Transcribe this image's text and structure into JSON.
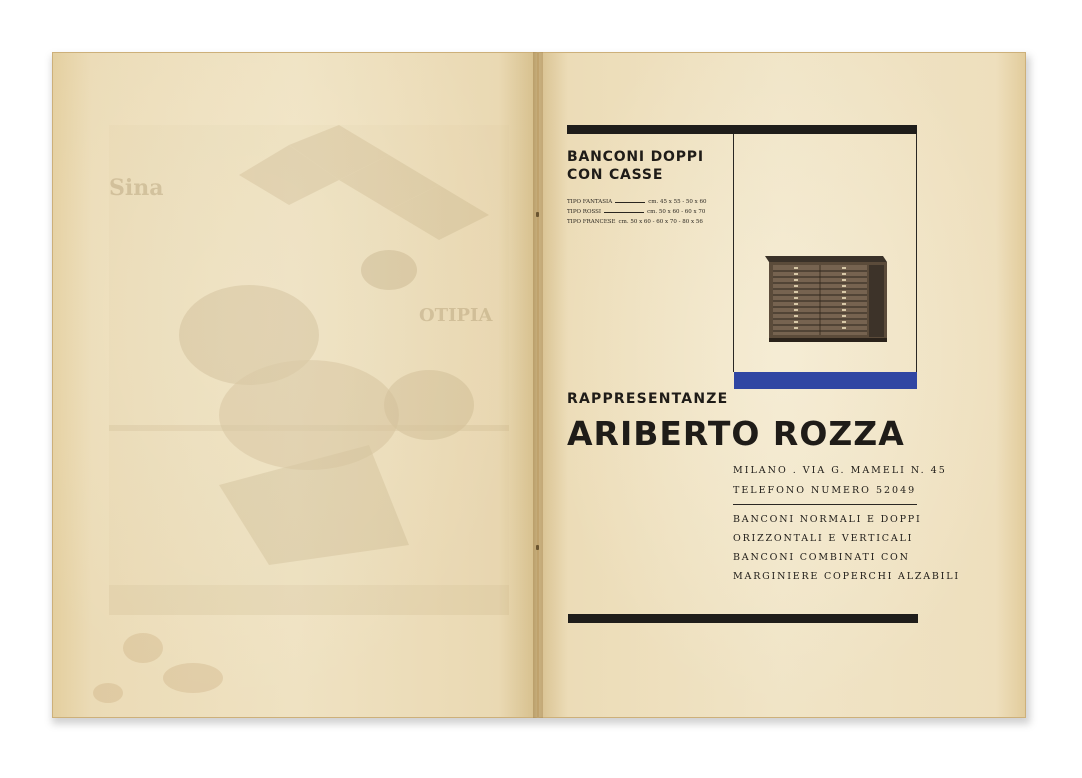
{
  "advertisement": {
    "headline": [
      "BANCONI DOPPI",
      "CON CASSE"
    ],
    "types": [
      {
        "name": "TIPO FANTASIA",
        "sizes": "cm. 45 x 55 - 50 x 60"
      },
      {
        "name": "TIPO ROSSI",
        "sizes": "cm. 50 x 60 - 60 x 70"
      },
      {
        "name": "TIPO FRANCESE",
        "sizes": "cm. 50 x 60 - 60 x 70 - 80 x 56"
      }
    ],
    "label": "RAPPRESENTANZE",
    "company": "ARIBERTO ROZZA",
    "address": "MILANO . VIA G. MAMELI N. 45",
    "phone": "TELEFONO NUMERO 52049",
    "services": [
      "BANCONI NORMALI E DOPPI",
      "ORIZZONTALI E VERTICALI",
      "BANCONI COMBINATI CON",
      "MARGINIERE COPERCHI ALZABILI"
    ],
    "colors": {
      "ink": "#1f1c18",
      "accent_blue": "#3046a3",
      "paper": "#efe2c2"
    }
  }
}
